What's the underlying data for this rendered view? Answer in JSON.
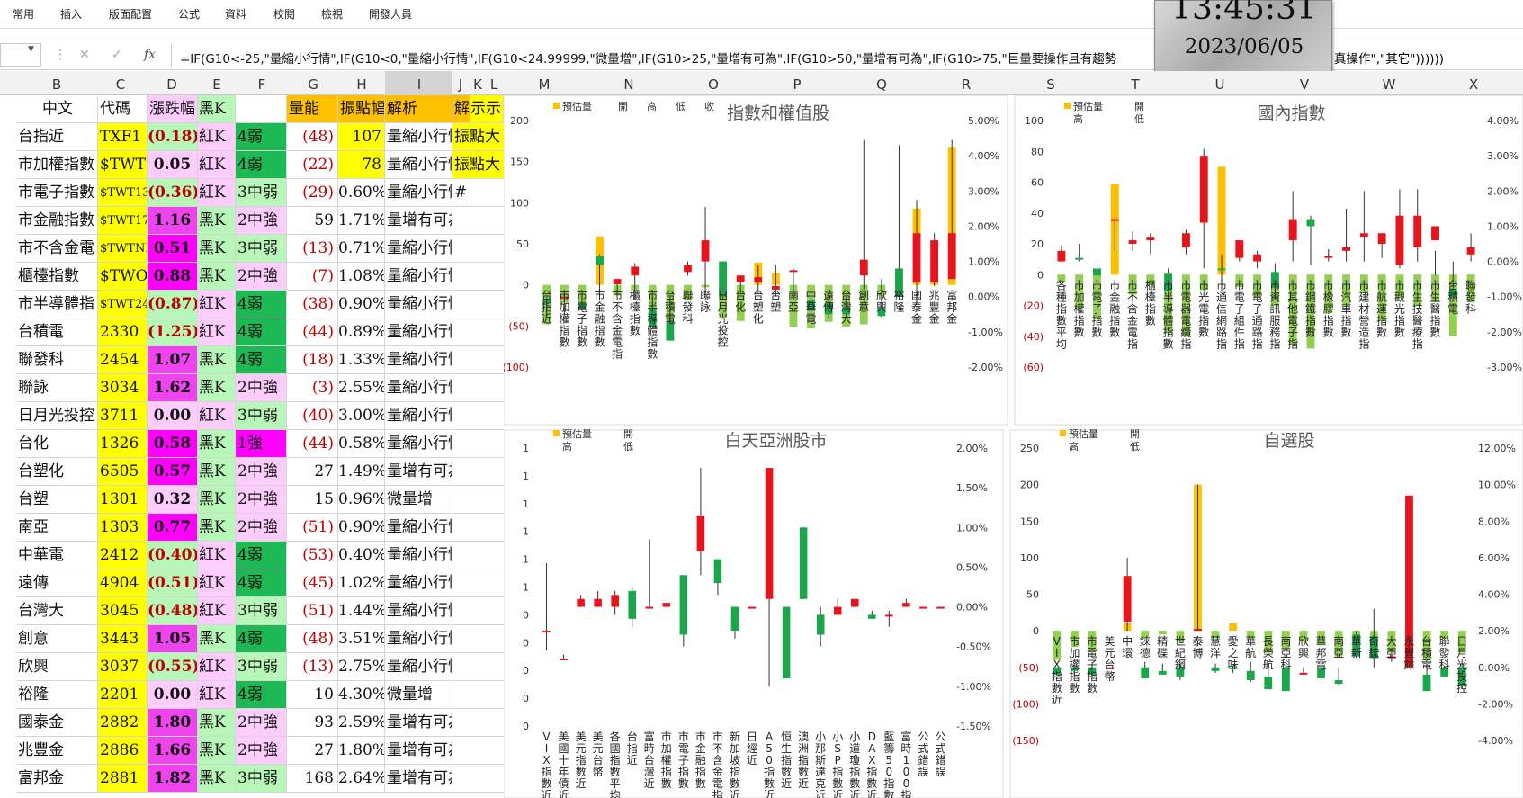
{
  "ribbon": {
    "tabs": [
      "常用",
      "插入",
      "版面配置",
      "公式",
      "資料",
      "校閱",
      "檢視",
      "開發人員"
    ]
  },
  "formula_bar": {
    "cancel_icon": "close-icon",
    "enter_icon": "check-icon",
    "fx_label": "fx",
    "formula": "=IF(G10<-25,\"量縮小行情\",IF(G10<0,\"量縮小行情\",IF(G10<24.99999,\"微量增\",IF(G10>25,\"量增有可為\",IF(G10>50,\"量增有可為\",IF(G10>75,\"巨量要操作且有趨勢",
    "formula_tail": "真操作\",\"其它\"))))))"
  },
  "clock": {
    "time": "13:45:31",
    "date": "2023/06/05"
  },
  "columns": [
    "B",
    "C",
    "D",
    "E",
    "F",
    "G",
    "H",
    "I",
    "J",
    "K",
    "L",
    "M",
    "N",
    "O",
    "P",
    "Q",
    "R",
    "S",
    "T",
    "U",
    "V",
    "W",
    "X"
  ],
  "table": {
    "headers": [
      "中文",
      "代碼",
      "漲跌幅",
      "黑K",
      "",
      "量能",
      "振點幅",
      "解析",
      "解析",
      "示示"
    ],
    "rows": [
      {
        "name": "台指近",
        "code": "TXF1",
        "chg": "(0.18)",
        "k": "紅K",
        "trend": "4弱",
        "vol": "(48)",
        "amp": "107",
        "analysis": "量縮小行情",
        "extra": "振點大"
      },
      {
        "name": "市加權指數",
        "code": "$TWT",
        "chg": "0.05",
        "k": "紅K",
        "trend": "4弱",
        "vol": "(22)",
        "amp": "78",
        "analysis": "量縮小行情",
        "extra": "振點大"
      },
      {
        "name": "市電子指數",
        "code": "$TWT13",
        "chg": "(0.36)",
        "k": "紅K",
        "trend": "3中弱",
        "vol": "(29)",
        "amp": "0.60%",
        "analysis": "量縮小行情",
        "extra": "#"
      },
      {
        "name": "市金融指數",
        "code": "$TWT17",
        "chg": "1.16",
        "k": "黑K",
        "trend": "2中強",
        "vol": "59",
        "amp": "1.71%",
        "analysis": "量增有可為",
        "extra": ""
      },
      {
        "name": "市不含金電",
        "code": "$TWTNB",
        "chg": "0.51",
        "k": "黑K",
        "trend": "3中弱",
        "vol": "(13)",
        "amp": "0.71%",
        "analysis": "量縮小行情",
        "extra": ""
      },
      {
        "name": "櫃檯指數",
        "code": "$TWO",
        "chg": "0.88",
        "k": "黑K",
        "trend": "2中強",
        "vol": "(7)",
        "amp": "1.08%",
        "analysis": "量縮小行情",
        "extra": ""
      },
      {
        "name": "市半導體指",
        "code": "$TWT24",
        "chg": "(0.87)",
        "k": "紅K",
        "trend": "4弱",
        "vol": "(38)",
        "amp": "0.90%",
        "analysis": "量縮小行情",
        "extra": ""
      },
      {
        "name": "台積電",
        "code": "2330",
        "chg": "(1.25)",
        "k": "紅K",
        "trend": "4弱",
        "vol": "(44)",
        "amp": "0.89%",
        "analysis": "量縮小行情",
        "extra": ""
      },
      {
        "name": "聯發科",
        "code": "2454",
        "chg": "1.07",
        "k": "黑K",
        "trend": "4弱",
        "vol": "(18)",
        "amp": "1.33%",
        "analysis": "量縮小行情",
        "extra": ""
      },
      {
        "name": "聯詠",
        "code": "3034",
        "chg": "1.62",
        "k": "黑K",
        "trend": "2中強",
        "vol": "(3)",
        "amp": "2.55%",
        "analysis": "量縮小行情",
        "extra": ""
      },
      {
        "name": "日月光投控",
        "code": "3711",
        "chg": "0.00",
        "k": "紅K",
        "trend": "3中弱",
        "vol": "(40)",
        "amp": "3.00%",
        "analysis": "量縮小行情",
        "extra": ""
      },
      {
        "name": "台化",
        "code": "1326",
        "chg": "0.58",
        "k": "黑K",
        "trend": "1強",
        "vol": "(44)",
        "amp": "0.58%",
        "analysis": "量縮小行情",
        "extra": ""
      },
      {
        "name": "台塑化",
        "code": "6505",
        "chg": "0.57",
        "k": "黑K",
        "trend": "2中強",
        "vol": "27",
        "amp": "1.49%",
        "analysis": "量增有可為",
        "extra": ""
      },
      {
        "name": "台塑",
        "code": "1301",
        "chg": "0.32",
        "k": "黑K",
        "trend": "2中強",
        "vol": "15",
        "amp": "0.96%",
        "analysis": "微量增",
        "extra": ""
      },
      {
        "name": "南亞",
        "code": "1303",
        "chg": "0.77",
        "k": "黑K",
        "trend": "2中強",
        "vol": "(51)",
        "amp": "0.90%",
        "analysis": "量縮小行情",
        "extra": ""
      },
      {
        "name": "中華電",
        "code": "2412",
        "chg": "(0.40)",
        "k": "紅K",
        "trend": "4弱",
        "vol": "(53)",
        "amp": "0.40%",
        "analysis": "量縮小行情",
        "extra": ""
      },
      {
        "name": "遠傳",
        "code": "4904",
        "chg": "(0.51)",
        "k": "紅K",
        "trend": "4弱",
        "vol": "(45)",
        "amp": "1.02%",
        "analysis": "量縮小行情",
        "extra": ""
      },
      {
        "name": "台灣大",
        "code": "3045",
        "chg": "(0.48)",
        "k": "紅K",
        "trend": "3中弱",
        "vol": "(51)",
        "amp": "1.44%",
        "analysis": "量縮小行情",
        "extra": ""
      },
      {
        "name": "創意",
        "code": "3443",
        "chg": "1.05",
        "k": "黑K",
        "trend": "4弱",
        "vol": "(48)",
        "amp": "3.51%",
        "analysis": "量縮小行情",
        "extra": ""
      },
      {
        "name": "欣興",
        "code": "3037",
        "chg": "(0.55)",
        "k": "紅K",
        "trend": "3中弱",
        "vol": "(13)",
        "amp": "2.75%",
        "analysis": "量縮小行情",
        "extra": ""
      },
      {
        "name": "裕隆",
        "code": "2201",
        "chg": "0.00",
        "k": "紅K",
        "trend": "4弱",
        "vol": "10",
        "amp": "4.30%",
        "analysis": "微量增",
        "extra": ""
      },
      {
        "name": "國泰金",
        "code": "2882",
        "chg": "1.80",
        "k": "黑K",
        "trend": "2中強",
        "vol": "93",
        "amp": "2.59%",
        "analysis": "量增有可為",
        "extra": ""
      },
      {
        "name": "兆豐金",
        "code": "2886",
        "chg": "1.66",
        "k": "黑K",
        "trend": "2中強",
        "vol": "27",
        "amp": "1.80%",
        "analysis": "量增有可為",
        "extra": ""
      },
      {
        "name": "富邦金",
        "code": "2881",
        "chg": "1.82",
        "k": "黑K",
        "trend": "3中弱",
        "vol": "168",
        "amp": "2.64%",
        "analysis": "量增有可為",
        "extra": ""
      }
    ]
  },
  "colors": {
    "yellow": "#ffff00",
    "pink": "#ff99ff",
    "lightpink": "#ffccff",
    "magenta": "#ff00ff",
    "green": "#1db954",
    "lightgreen": "#b7f7b7",
    "orange": "#ffc000",
    "red_text": "#c00000",
    "candle_red": "#e8141c",
    "candle_green": "#1aa64a",
    "vol_gold": "#ffc000",
    "vol_green": "#92d050"
  },
  "chart_data": [
    {
      "type": "candlestick",
      "title": "指數和權值股",
      "legend": [
        "預估量",
        "開",
        "高",
        "低",
        "收"
      ],
      "y_left_ticks": [
        "200",
        "150",
        "100",
        "50",
        "0",
        "(50)",
        "(100)"
      ],
      "y_right_ticks": [
        "5.00%",
        "4.00%",
        "3.00%",
        "2.00%",
        "1.00%",
        "0.00%",
        "-1.00%",
        "-2.00%"
      ],
      "ylim_left": [
        -100,
        200
      ],
      "ylim_right": [
        -2,
        5
      ],
      "categories": [
        "台指近",
        "市加權指數",
        "市電子指數",
        "市金融指數",
        "市不含金電指",
        "櫃檯指數",
        "市半導體指數",
        "台積電",
        "聯發科",
        "聯詠",
        "日月光投控",
        "台化",
        "台塑化",
        "台塑",
        "南亞",
        "中華電",
        "遠傳",
        "台灣大",
        "創意",
        "欣興",
        "裕隆",
        "國泰金",
        "兆豐金",
        "富邦金"
      ],
      "volume": [
        -48,
        -22,
        -29,
        59,
        -13,
        -7,
        -38,
        -44,
        -18,
        -3,
        -40,
        -44,
        27,
        15,
        -51,
        -53,
        -45,
        -51,
        -48,
        -13,
        10,
        93,
        27,
        168
      ],
      "open": [
        -0.1,
        -0.05,
        -0.2,
        1.15,
        0.35,
        0.6,
        -0.35,
        -0.7,
        0.7,
        1.0,
        1.0,
        0.4,
        0.4,
        0.2,
        0.7,
        -0.1,
        -0.2,
        -0.3,
        0.6,
        -0.3,
        0.8,
        0.4,
        0.4,
        0.5
      ],
      "high": [
        0.0,
        0.1,
        0.05,
        1.2,
        0.5,
        0.95,
        0.0,
        0.0,
        1.0,
        2.55,
        1.0,
        0.55,
        0.9,
        0.9,
        0.8,
        0.0,
        0.0,
        0.0,
        4.45,
        0.5,
        4.3,
        2.75,
        1.8,
        4.45
      ],
      "low": [
        -0.55,
        -0.5,
        -0.35,
        -0.1,
        0.15,
        -0.1,
        -0.85,
        -1.25,
        0.6,
        0.0,
        -0.1,
        0.1,
        0.1,
        0.0,
        0.2,
        -0.45,
        -0.6,
        -0.5,
        0.2,
        -0.6,
        0.0,
        -0.2,
        0.3,
        0.5
      ],
      "close": [
        -0.2,
        0.0,
        -0.35,
        0.9,
        0.5,
        0.85,
        -0.85,
        -1.25,
        0.9,
        1.6,
        0.0,
        0.6,
        0.55,
        0.3,
        0.75,
        -0.4,
        -0.5,
        -0.5,
        1.05,
        -0.55,
        0.0,
        1.8,
        1.6,
        1.8
      ]
    },
    {
      "type": "candlestick",
      "title": "國內指數",
      "legend": [
        "預估量",
        "開",
        "高",
        "低"
      ],
      "y_left_ticks": [
        "100",
        "80",
        "60",
        "40",
        "20",
        "0",
        "(20)",
        "(40)",
        "(60)"
      ],
      "y_right_ticks": [
        "4.00%",
        "3.00%",
        "2.00%",
        "1.00%",
        "0.00%",
        "-1.00%",
        "-2.00%",
        "-3.00%"
      ],
      "ylim_left": [
        -60,
        100
      ],
      "ylim_right": [
        -3,
        4
      ],
      "categories": [
        "各種指數平均",
        "市加權指數",
        "市電子指數",
        "市金融指數",
        "市不含金電指",
        "櫃檯指數",
        "市半導體指數",
        "市電器電纜指",
        "市光電指數",
        "市通信網路指",
        "市電子組件指",
        "市電子通路指",
        "市資訊服務指",
        "市其他電子指",
        "市鋼鐵指數",
        "市橡膠指數",
        "市汽車指數",
        "市建材營造指",
        "市航運指數",
        "市觀光指數",
        "市生技醫療指",
        "市生醫指數",
        "台積電",
        "聯發科"
      ],
      "volume": [
        -5,
        -22,
        -29,
        59,
        -13,
        -7,
        -38,
        -40,
        -10,
        70,
        -8,
        -15,
        -20,
        -45,
        -48,
        -25,
        -20,
        -12,
        -30,
        -15,
        -20,
        -18,
        -40,
        -18
      ],
      "open": [
        0.0,
        0.1,
        -0.2,
        1.2,
        0.5,
        0.6,
        -0.35,
        0.4,
        1.1,
        -0.2,
        0.1,
        0.0,
        -0.3,
        0.6,
        1.2,
        0.1,
        0.3,
        0.7,
        0.5,
        -0.1,
        0.4,
        0.6,
        -0.8,
        0.2
      ],
      "high": [
        0.45,
        0.5,
        0.05,
        1.15,
        0.85,
        0.8,
        -0.2,
        0.9,
        3.2,
        0.2,
        0.6,
        0.3,
        -0.05,
        2.0,
        1.3,
        0.35,
        1.5,
        2.0,
        0.8,
        2.05,
        2.05,
        0.3,
        0.0,
        0.8
      ],
      "low": [
        0.0,
        0.0,
        -0.35,
        0.3,
        0.3,
        0.2,
        -0.85,
        0.2,
        -0.2,
        -0.7,
        0.0,
        -0.2,
        -1.1,
        0.0,
        -0.1,
        0.0,
        0.0,
        0.0,
        0.1,
        -0.2,
        0.0,
        -0.4,
        -1.0,
        0.0
      ],
      "close": [
        0.3,
        0.05,
        -0.4,
        1.2,
        0.6,
        0.7,
        -0.85,
        0.8,
        3.0,
        -0.25,
        0.6,
        0.2,
        -0.75,
        1.2,
        1.0,
        0.15,
        0.4,
        0.8,
        0.8,
        1.3,
        1.3,
        1.0,
        -1.0,
        0.4
      ]
    },
    {
      "type": "candlestick",
      "title": "白天亞洲股市",
      "legend": [
        "預估量",
        "開",
        "高",
        "低"
      ],
      "y_left_ticks": [
        "1",
        "1",
        "1",
        "1",
        "1",
        "1",
        "0",
        "0",
        "0",
        "0",
        "0"
      ],
      "y_right_ticks": [
        "2.00%",
        "1.50%",
        "1.00%",
        "0.50%",
        "0.00%",
        "-0.50%",
        "-1.00%",
        "-1.50%"
      ],
      "ylim_right": [
        -1.5,
        2.0
      ],
      "categories": [
        "VIX指數近",
        "美國十年債近",
        "美元指數近",
        "美元台幣",
        "各國指數平均",
        "台指近",
        "富時台灣近",
        "市加權指數",
        "市電子指數",
        "市金融指數",
        "市不含金電指",
        "新加坡指數近",
        "日經近",
        "A50指數近",
        "恒生指數近",
        "澳洲指數近",
        "小那斯達克近",
        "小SP指數近",
        "小道瓊指數近",
        "DAX指數近",
        "藍籌50指數近",
        "富時100指數近",
        "公式錯誤",
        "公式錯誤"
      ],
      "open": [
        -0.3,
        -0.65,
        0.0,
        0.0,
        0.0,
        0.2,
        0.0,
        0.0,
        0.4,
        0.7,
        0.6,
        0.0,
        0.0,
        0.1,
        0.0,
        1.0,
        -0.1,
        -0.1,
        0.0,
        -0.1,
        -0.1,
        0.0,
        0.0,
        0.0
      ],
      "high": [
        0.55,
        -0.6,
        0.15,
        0.2,
        0.2,
        0.25,
        0.85,
        0.05,
        0.0,
        1.75,
        0.55,
        0.0,
        0.0,
        1.75,
        -0.1,
        1.0,
        0.0,
        0.1,
        0.1,
        -0.05,
        -0.05,
        0.1,
        0.0,
        0.0
      ],
      "low": [
        -0.55,
        -0.65,
        0.0,
        0.0,
        -0.1,
        -0.25,
        0.0,
        0.0,
        -0.5,
        0.4,
        0.15,
        -0.4,
        0.0,
        -1.0,
        -0.85,
        0.1,
        -0.5,
        -0.1,
        0.0,
        -0.15,
        -0.25,
        0.0,
        0.0,
        0.0
      ],
      "close": [
        -0.3,
        -0.65,
        0.1,
        0.1,
        0.15,
        -0.15,
        0.0,
        0.05,
        -0.35,
        1.15,
        0.3,
        -0.3,
        0.0,
        1.75,
        -0.9,
        0.1,
        -0.35,
        0.0,
        0.1,
        -0.15,
        -0.1,
        0.05,
        0.0,
        0.0
      ]
    },
    {
      "type": "candlestick",
      "title": "自選股",
      "legend": [
        "預估量",
        "開",
        "高",
        "低"
      ],
      "y_left_ticks": [
        "250",
        "200",
        "150",
        "100",
        "50",
        "0",
        "(50)",
        "(100)",
        "(150)"
      ],
      "y_right_ticks": [
        "12.00%",
        "10.00%",
        "8.00%",
        "6.00%",
        "4.00%",
        "2.00%",
        "0.00%",
        "-2.00%",
        "-4.00%"
      ],
      "ylim_left": [
        -150,
        250
      ],
      "ylim_right": [
        -4,
        12
      ],
      "categories": [
        "VIX指數近",
        "市加權指數",
        "市電子指數",
        "美元台幣",
        "中環",
        "錸德",
        "精碟",
        "世紀鋼",
        "泰博",
        "慧洋",
        "愛之味",
        "華航",
        "長榮航",
        "南亞科",
        "欣興",
        "華邦電",
        "南亞",
        "華新",
        "奇鋐",
        "大亞",
        "永豐餘",
        "台積電",
        "聯發科",
        "日月光投控"
      ],
      "volume": [
        -40,
        -22,
        -29,
        0,
        10,
        -10,
        -5,
        -15,
        200,
        -10,
        10,
        -10,
        -30,
        -25,
        -15,
        -20,
        -35,
        -5,
        -20,
        -30,
        -45,
        -40,
        -10,
        -30
      ],
      "open": [
        0.0,
        0.0,
        0.0,
        0.0,
        2.5,
        0.0,
        -0.2,
        0.0,
        2.0,
        0.0,
        0.0,
        -0.2,
        -0.5,
        0.0,
        -0.3,
        0.0,
        -0.7,
        1.8,
        1.7,
        0.5,
        0.0,
        -0.4,
        0.0,
        0.0
      ],
      "high": [
        0.0,
        0.0,
        0.0,
        0.0,
        6.0,
        0.3,
        0.2,
        0.2,
        10.0,
        0.2,
        0.1,
        0.3,
        0.0,
        0.1,
        0.0,
        0.3,
        0.0,
        2.0,
        3.2,
        1.0,
        9.4,
        0.2,
        0.1,
        0.2
      ],
      "low": [
        -0.4,
        -0.5,
        -0.6,
        0.0,
        2.0,
        -0.6,
        -0.4,
        -0.7,
        2.0,
        -0.3,
        -0.3,
        -0.8,
        -1.2,
        -1.3,
        -0.4,
        -0.7,
        -1.0,
        0.5,
        0.0,
        0.3,
        0.0,
        -1.3,
        -0.5,
        -1.2
      ],
      "close": [
        -0.4,
        -0.2,
        -0.4,
        0.0,
        5.0,
        -0.6,
        -0.4,
        -0.5,
        2.1,
        -0.2,
        -0.1,
        -0.7,
        -1.2,
        -1.3,
        -0.3,
        -0.6,
        -0.9,
        0.6,
        0.5,
        0.6,
        9.4,
        -1.3,
        -0.5,
        -1.0
      ]
    }
  ]
}
